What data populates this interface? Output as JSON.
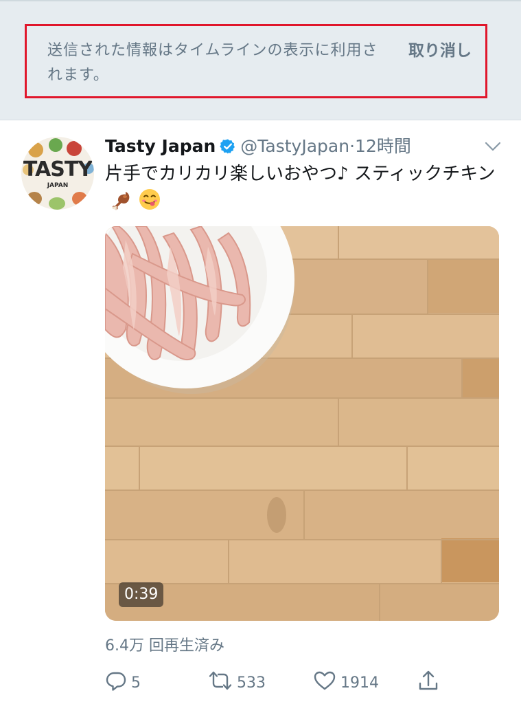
{
  "notice": {
    "message": "送信された情報はタイムラインの表示に利用されます。",
    "undo_label": "取り消し",
    "highlight_color": "#e0162b"
  },
  "tweet": {
    "avatar": {
      "brand_text": "TASTY",
      "brand_sub": "JAPAN"
    },
    "display_name": "Tasty Japan",
    "verified_icon": "verified-badge-icon",
    "handle": "@TastyJapan",
    "separator": "·",
    "time": "12時間",
    "text": "片手でカリカリ楽しいおやつ♪ スティックチキン",
    "emojis": [
      "poultry-leg-emoji",
      "yum-face-emoji"
    ],
    "media": {
      "type": "video",
      "duration": "0:39"
    },
    "view_count": "6.4万 回再生済み",
    "actions": {
      "reply_count": "5",
      "retweet_count": "533",
      "like_count": "1914"
    },
    "colors": {
      "verified": "#1da1f2",
      "secondary_text": "#657786",
      "primary_text": "#14171a"
    }
  }
}
